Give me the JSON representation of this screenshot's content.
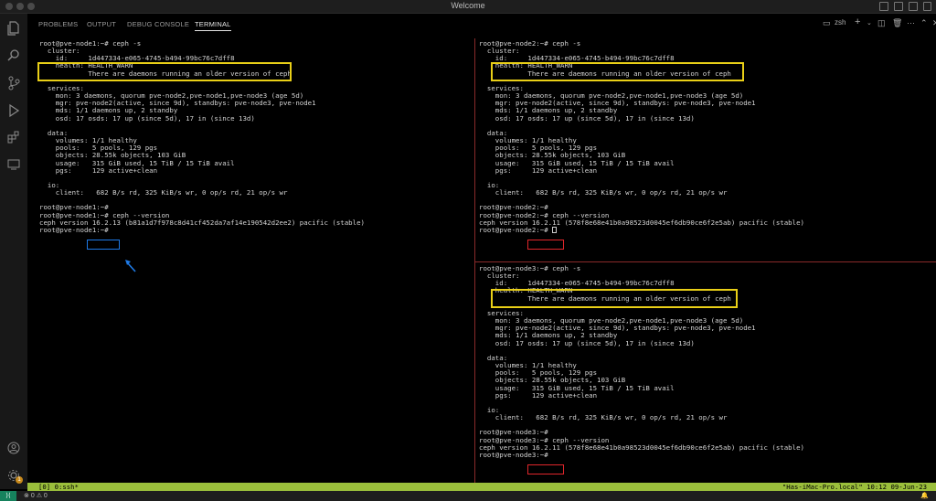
{
  "window": {
    "title": "Welcome"
  },
  "panel": {
    "tabs": [
      "PROBLEMS",
      "OUTPUT",
      "DEBUG CONSOLE",
      "TERMINAL"
    ],
    "active_tab": "TERMINAL",
    "shell_label": "zsh",
    "icons": [
      "terminal-icon",
      "plus-icon",
      "chevron-down-icon",
      "split-icon",
      "trash-icon",
      "more-icon",
      "maximize-icon",
      "close-icon"
    ]
  },
  "activity_bar": {
    "icons": [
      "explorer-icon",
      "search-icon",
      "source-control-icon",
      "run-debug-icon",
      "extensions-icon",
      "remote-explorer-icon"
    ],
    "bottom_icons": [
      "account-icon",
      "settings-gear-icon"
    ],
    "settings_badge": "1"
  },
  "terminals": {
    "node1": {
      "lines": [
        "root@pve-node1:~# ceph -s",
        "  cluster:",
        "    id:     1d447334-e065-4745-b494-99bc76c7dff8",
        "    health: HEALTH_WARN",
        "            There are daemons running an older version of ceph",
        "",
        "  services:",
        "    mon: 3 daemons, quorum pve-node2,pve-node1,pve-node3 (age 5d)",
        "    mgr: pve-node2(active, since 9d), standbys: pve-node3, pve-node1",
        "    mds: 1/1 daemons up, 2 standby",
        "    osd: 17 osds: 17 up (since 5d), 17 in (since 13d)",
        "",
        "  data:",
        "    volumes: 1/1 healthy",
        "    pools:   5 pools, 129 pgs",
        "    objects: 28.55k objects, 103 GiB",
        "    usage:   315 GiB used, 15 TiB / 15 TiB avail",
        "    pgs:     129 active+clean",
        "",
        "  io:",
        "    client:   682 B/s rd, 325 KiB/s wr, 0 op/s rd, 21 op/s wr",
        "",
        "root@pve-node1:~#",
        "root@pve-node1:~# ceph --version",
        "ceph version 16.2.13 (b81a1d7f978c8d41cf452da7af14e190542d2ee2) pacific (stable)",
        "root@pve-node1:~#"
      ]
    },
    "node2": {
      "lines": [
        "root@pve-node2:~# ceph -s",
        "  cluster:",
        "    id:     1d447334-e065-4745-b494-99bc76c7dff8",
        "    health: HEALTH_WARN",
        "            There are daemons running an older version of ceph",
        "",
        "  services:",
        "    mon: 3 daemons, quorum pve-node2,pve-node1,pve-node3 (age 5d)",
        "    mgr: pve-node2(active, since 9d), standbys: pve-node3, pve-node1",
        "    mds: 1/1 daemons up, 2 standby",
        "    osd: 17 osds: 17 up (since 5d), 17 in (since 13d)",
        "",
        "  data:",
        "    volumes: 1/1 healthy",
        "    pools:   5 pools, 129 pgs",
        "    objects: 28.55k objects, 103 GiB",
        "    usage:   315 GiB used, 15 TiB / 15 TiB avail",
        "    pgs:     129 active+clean",
        "",
        "  io:",
        "    client:   682 B/s rd, 325 KiB/s wr, 0 op/s rd, 21 op/s wr",
        "",
        "root@pve-node2:~#",
        "root@pve-node2:~# ceph --version",
        "ceph version 16.2.11 (578f8e68e41b0a98523d0045ef6db90ce6f2e5ab) pacific (stable)",
        "root@pve-node2:~# "
      ]
    },
    "node3": {
      "lines": [
        "root@pve-node3:~# ceph -s",
        "  cluster:",
        "    id:     1d447334-e065-4745-b494-99bc76c7dff8",
        "    health: HEALTH_WARN",
        "            There are daemons running an older version of ceph",
        "",
        "  services:",
        "    mon: 3 daemons, quorum pve-node2,pve-node1,pve-node3 (age 5d)",
        "    mgr: pve-node2(active, since 9d), standbys: pve-node3, pve-node1",
        "    mds: 1/1 daemons up, 2 standby",
        "    osd: 17 osds: 17 up (since 5d), 17 in (since 13d)",
        "",
        "  data:",
        "    volumes: 1/1 healthy",
        "    pools:   5 pools, 129 pgs",
        "    objects: 28.55k objects, 103 GiB",
        "    usage:   315 GiB used, 15 TiB / 15 TiB avail",
        "    pgs:     129 active+clean",
        "",
        "  io:",
        "    client:   682 B/s rd, 325 KiB/s wr, 0 op/s rd, 21 op/s wr",
        "",
        "root@pve-node3:~#",
        "root@pve-node3:~# ceph --version",
        "ceph version 16.2.11 (578f8e68e41b0a98523d0045ef6db90ce6f2e5ab) pacific (stable)",
        "root@pve-node3:~#"
      ]
    }
  },
  "tmux": {
    "left": "[0] 0:ssh*",
    "right": "\"Has-iMac-Pro.local\" 10:12 09-Jun-23"
  },
  "statusbar": {
    "errors": "0",
    "warnings": "0"
  },
  "colors": {
    "highlight_yellow": "#e9cf17",
    "highlight_blue": "#1e7ae6",
    "highlight_red": "#e0262b",
    "tmux_green": "#9bbf3b"
  }
}
